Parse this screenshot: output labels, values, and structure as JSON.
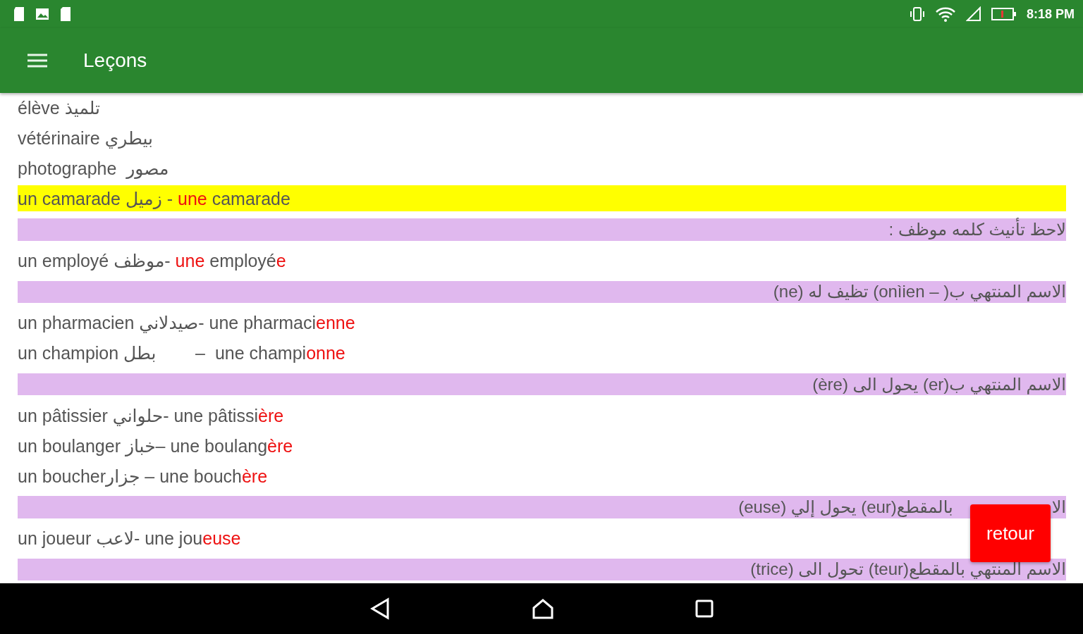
{
  "status_bar": {
    "time": "8:18 PM"
  },
  "toolbar": {
    "title": "Leçons"
  },
  "rows": [
    {
      "kind": "line",
      "highlighted": false,
      "text": "élève تلميذ"
    },
    {
      "kind": "line",
      "highlighted": false,
      "text": "vétérinaire بيطري"
    },
    {
      "kind": "line",
      "highlighted": false,
      "text": "photographe  مصور"
    },
    {
      "kind": "line",
      "highlighted": true,
      "text": "un camarade زميل - ",
      "red_article": "une",
      "text_after": " camarade"
    },
    {
      "kind": "note",
      "text": "لاحظ تأنيث كلمه موظف :"
    },
    {
      "kind": "line",
      "highlighted": false,
      "text": "un employé موظف- ",
      "red_article": "une",
      "text_after": " employé",
      "red_ending": "e"
    },
    {
      "kind": "note",
      "text": "الاسم المنتهي ب( – onìien) تظيف له (ne)"
    },
    {
      "kind": "line",
      "highlighted": false,
      "text": "un pharmacien صيدلاني- une pharmaci",
      "red_ending": "enne"
    },
    {
      "kind": "line",
      "highlighted": false,
      "text": "un champion بطل        –  une champi",
      "red_ending": "onne"
    },
    {
      "kind": "note",
      "text": "الاسم المنتهي ب(er) يحول الى (ère)"
    },
    {
      "kind": "line",
      "highlighted": false,
      "text": "un pâtissier حلواني- une pâtissi",
      "red_ending": "ère"
    },
    {
      "kind": "line",
      "highlighted": false,
      "text": "un boulanger خباز– une boulang",
      "red_ending": "ère"
    },
    {
      "kind": "line",
      "highlighted": false,
      "text": "un boucherجزار – une bouch",
      "red_ending": "ère"
    },
    {
      "kind": "note",
      "text": "بالمقطع(eur) يحول إلي (euse)",
      "edge": "الا"
    },
    {
      "kind": "line",
      "highlighted": false,
      "text": "un joueur لاعب- une jou",
      "red_ending": "euse"
    },
    {
      "kind": "note",
      "text": "الاسم المنتهي بالمقطع(teur) تحول الى (trice)"
    }
  ],
  "retour_button": {
    "label": "retour"
  }
}
